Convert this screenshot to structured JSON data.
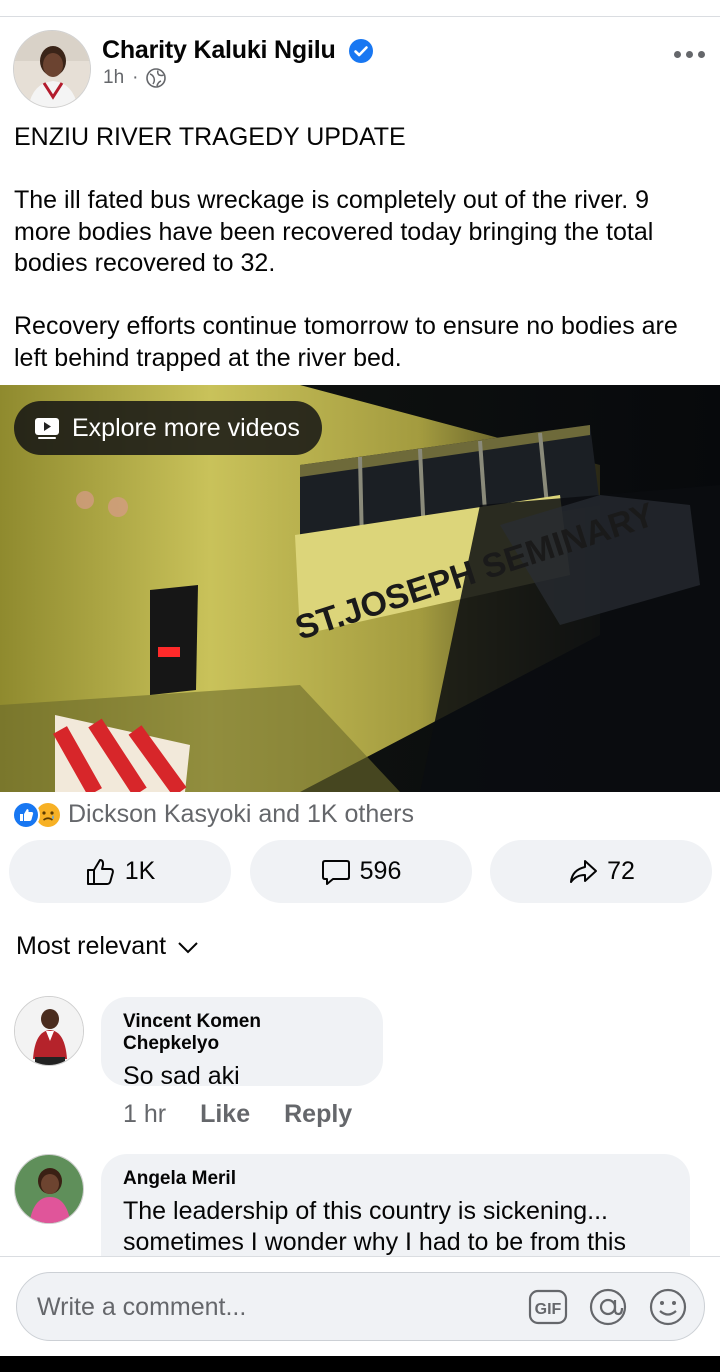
{
  "post": {
    "author": "Charity Kaluki Ngilu",
    "time": "1h",
    "separator": "·",
    "paragraphs": [
      "ENZIU RIVER TRAGEDY UPDATE",
      "The ill fated bus wreckage is completely out of the river. 9 more bodies have been recovered today bringing the total bodies recovered to 32.",
      "Recovery efforts continue tomorrow to ensure no bodies are left behind trapped at the river bed."
    ]
  },
  "video": {
    "explore_label": "Explore more videos",
    "bus_text": "ST.JOSEPH SEMINARY"
  },
  "reactions": {
    "summary": "Dickson Kasyoki and 1K others",
    "icons": [
      "like-icon",
      "sad-icon"
    ]
  },
  "actions": {
    "like_count": "1K",
    "comment_count": "596",
    "share_count": "72"
  },
  "sort": {
    "label": "Most relevant"
  },
  "comments": [
    {
      "name": "Vincent Komen Chepkelyo",
      "text": "So sad aki",
      "time": "1 hr",
      "like": "Like",
      "reply": "Reply"
    },
    {
      "name": "Angela Meril",
      "text": "The leadership of this country is sickening... sometimes I wonder why I had to be from this"
    }
  ],
  "composer": {
    "placeholder": "Write a comment...",
    "gif_label": "GIF"
  },
  "colors": {
    "accent": "#1877f2",
    "secondary_text": "#65676b",
    "pill_bg": "#f0f2f5"
  }
}
